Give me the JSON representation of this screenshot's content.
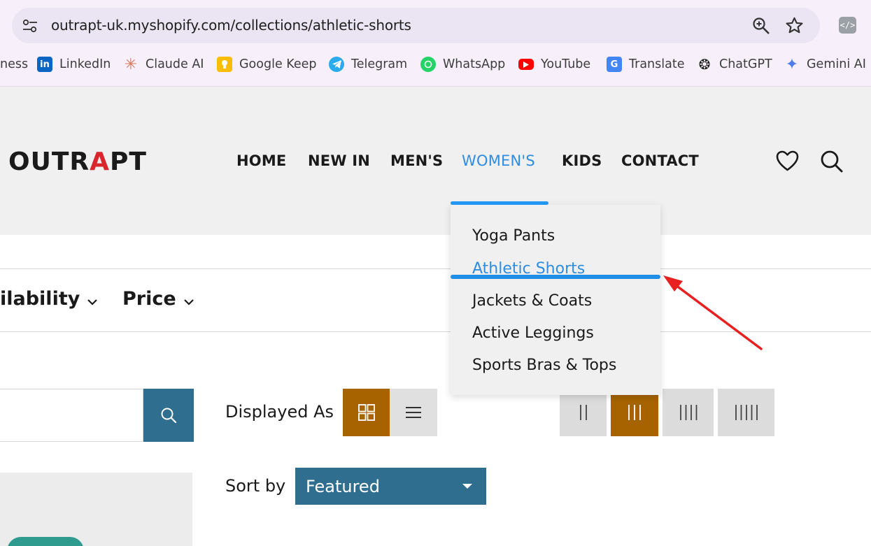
{
  "browser": {
    "url": "outrapt-uk.myshopify.com/collections/athletic-shorts",
    "bookmarks": [
      {
        "label": "ness",
        "icon": "business-icon"
      },
      {
        "label": "LinkedIn",
        "icon": "linkedin-icon",
        "color": "#0a66c2"
      },
      {
        "label": "Claude AI",
        "icon": "claude-icon",
        "color": "#d97757"
      },
      {
        "label": "Google Keep",
        "icon": "google-keep-icon",
        "color": "#fbbc04"
      },
      {
        "label": "Telegram",
        "icon": "telegram-icon",
        "color": "#2aabee"
      },
      {
        "label": "WhatsApp",
        "icon": "whatsapp-icon",
        "color": "#25d366"
      },
      {
        "label": "YouTube",
        "icon": "youtube-icon",
        "color": "#ff0000"
      },
      {
        "label": "Translate",
        "icon": "translate-icon",
        "color": "#4285f4"
      },
      {
        "label": "ChatGPT",
        "icon": "chatgpt-icon",
        "color": "#1a1a1a"
      },
      {
        "label": "Gemini AI",
        "icon": "gemini-icon",
        "color": "#4b7bec"
      }
    ]
  },
  "header": {
    "logo": {
      "prefix": "OUTR",
      "mark": "A",
      "suffix": "PT"
    },
    "nav": [
      "HOME",
      "NEW IN",
      "MEN'S",
      "WOMEN'S",
      "KIDS",
      "CONTACT"
    ],
    "active_nav": "WOMEN'S",
    "accent_color": "#2e8de0"
  },
  "dropdown": {
    "items": [
      "Yoga Pants",
      "Athletic Shorts",
      "Jackets & Coats",
      "Active Leggings",
      "Sports Bras & Tops"
    ],
    "highlighted": "Athletic Shorts"
  },
  "filters": {
    "availability": "ilability",
    "price": "Price"
  },
  "toolbar": {
    "displayed_as": "Displayed As",
    "sort_by": "Sort by",
    "sort_value": "Featured",
    "active_color": "#a66300",
    "select_color": "#2f6e8f"
  },
  "annotation": {
    "arrow_color": "#e8201f"
  }
}
